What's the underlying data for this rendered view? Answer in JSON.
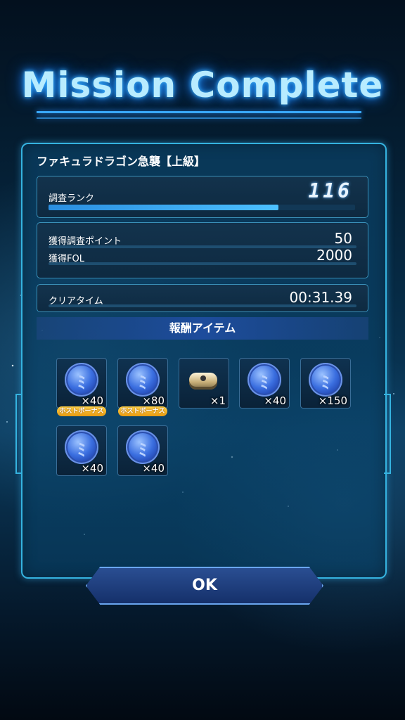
{
  "title": "Mission Complete",
  "mission_name": "ファキュラドラゴン急襲【上級】",
  "rank": {
    "label": "調査ランク",
    "value": "116",
    "progress": 0.75
  },
  "earnings": {
    "points_label": "獲得調査ポイント",
    "points_value": "50",
    "fol_label": "獲得FOL",
    "fol_value": "2000"
  },
  "clear_time": {
    "label": "クリアタイム",
    "value": "00:31.39"
  },
  "rewards_header": "報酬アイテム",
  "rewards": [
    {
      "icon": "blue-coin-icon",
      "qty": "×40",
      "bonus": "ホストボーナス"
    },
    {
      "icon": "blue-coin-icon",
      "qty": "×80",
      "bonus": "ホストボーナス"
    },
    {
      "icon": "ring-item-icon",
      "qty": "×1",
      "bonus": ""
    },
    {
      "icon": "blue-coin-icon",
      "qty": "×40",
      "bonus": ""
    },
    {
      "icon": "blue-coin-icon",
      "qty": "×150",
      "bonus": ""
    },
    {
      "icon": "blue-coin-icon",
      "qty": "×40",
      "bonus": ""
    },
    {
      "icon": "blue-coin-icon",
      "qty": "×40",
      "bonus": ""
    }
  ],
  "ok_label": "OK",
  "colors": {
    "accent": "#35b3e0",
    "bonus": "#f0b020",
    "title_glow": "#1a8cff"
  }
}
